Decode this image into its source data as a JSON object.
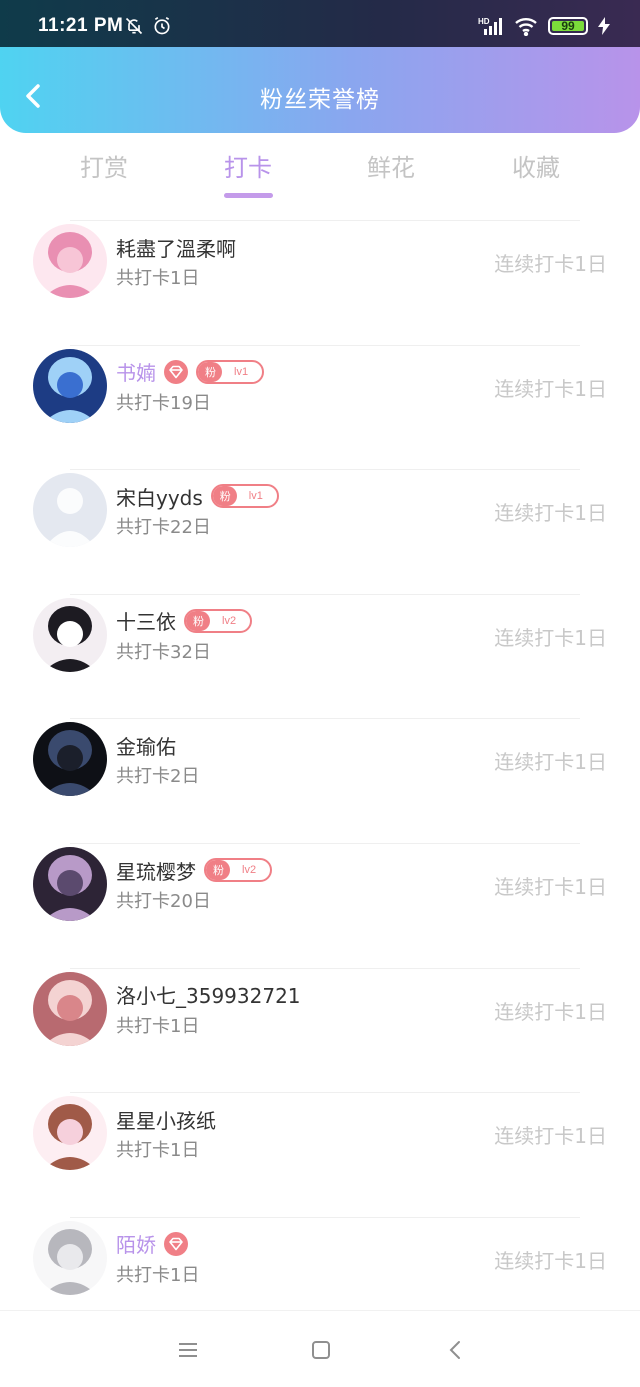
{
  "status_bar": {
    "time": "11:21 PM",
    "battery": "99",
    "network": "HD"
  },
  "header": {
    "title": "粉丝荣誉榜"
  },
  "tabs": [
    {
      "label": "打赏",
      "active": false
    },
    {
      "label": "打卡",
      "active": true
    },
    {
      "label": "鲜花",
      "active": false
    },
    {
      "label": "收藏",
      "active": false
    }
  ],
  "colors": {
    "header_gradient_start": "#4fd3f1",
    "header_gradient_end": "#b893ea",
    "accent_purple": "#b893ea",
    "badge_red": "#f07f86",
    "streak_gray": "#c8c8c8"
  },
  "users": [
    {
      "name": "耗盡了溫柔啊",
      "total": "共打卡1日",
      "streak": "连续打卡1日",
      "vip": false,
      "fan_badge": null,
      "avatar_icon": "avatar-pink-anime-girl"
    },
    {
      "name": "书婻",
      "total": "共打卡19日",
      "streak": "连续打卡1日",
      "vip": true,
      "fan_badge": {
        "label": "粉",
        "level": "lv1"
      },
      "avatar_icon": "avatar-blue-anime"
    },
    {
      "name": "宋白yyds",
      "total": "共打卡22日",
      "streak": "连续打卡1日",
      "vip": false,
      "fan_badge": {
        "label": "粉",
        "level": "lv1"
      },
      "avatar_icon": "avatar-default-silhouette"
    },
    {
      "name": "十三依",
      "total": "共打卡32日",
      "streak": "连续打卡1日",
      "vip": false,
      "fan_badge": {
        "label": "粉",
        "level": "lv2"
      },
      "avatar_icon": "avatar-dark-hair-girl"
    },
    {
      "name": "金瑜佑",
      "total": "共打卡2日",
      "streak": "连续打卡1日",
      "vip": false,
      "fan_badge": null,
      "avatar_icon": "avatar-dark-photo"
    },
    {
      "name": "星琉樱梦",
      "total": "共打卡20日",
      "streak": "连续打卡1日",
      "vip": false,
      "fan_badge": {
        "label": "粉",
        "level": "lv2"
      },
      "avatar_icon": "avatar-purple-anime"
    },
    {
      "name": "洛小七_359932721",
      "total": "共打卡1日",
      "streak": "连续打卡1日",
      "vip": false,
      "fan_badge": null,
      "avatar_icon": "avatar-pink-cartoon"
    },
    {
      "name": "星星小孩纸",
      "total": "共打卡1日",
      "streak": "连续打卡1日",
      "vip": false,
      "fan_badge": null,
      "avatar_icon": "avatar-pink-girl-bow"
    },
    {
      "name": "陌娇",
      "total": "共打卡1日",
      "streak": "连续打卡1日",
      "vip": true,
      "fan_badge": null,
      "avatar_icon": "avatar-white-hair-anime"
    }
  ],
  "system_nav": {
    "menu_icon": "menu-icon",
    "home_icon": "home-square-icon",
    "back_icon": "back-triangle-icon"
  }
}
